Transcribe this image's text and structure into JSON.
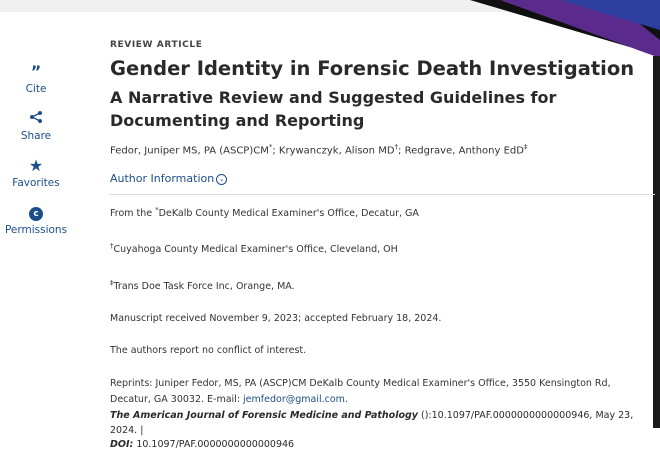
{
  "sidebar": {
    "items": [
      {
        "label": "Cite",
        "icon": "quote-icon",
        "glyph": "”"
      },
      {
        "label": "Share",
        "icon": "share-icon",
        "glyph": "<"
      },
      {
        "label": "Favorites",
        "icon": "star-icon",
        "glyph": "★"
      },
      {
        "label": "Permissions",
        "icon": "copyright-icon",
        "glyph": "c"
      }
    ]
  },
  "article": {
    "kicker": "REVIEW ARTICLE",
    "title": "Gender Identity in Forensic Death Investigation",
    "subtitle": "A Narrative Review and Suggested Guidelines for Documenting and Reporting",
    "authors": {
      "a1": "Fedor, Juniper MS, PA (ASCP)CM",
      "a1_sup": "*",
      "sep1": "; ",
      "a2": "Krywanczyk, Alison MD",
      "a2_sup": "†",
      "sep2": "; ",
      "a3": "Redgrave, Anthony EdD",
      "a3_sup": "‡"
    },
    "author_info_label": "Author Information",
    "affiliations": [
      {
        "sup": "*",
        "text": "DeKalb County Medical Examiner's Office, Decatur, GA",
        "prefix": "From the "
      },
      {
        "sup": "†",
        "text": "Cuyahoga County Medical Examiner's Office, Cleveland, OH",
        "prefix": ""
      },
      {
        "sup": "‡",
        "text": "Trans Doe Task Force Inc, Orange, MA.",
        "prefix": ""
      }
    ],
    "manuscript": "Manuscript received November 9, 2023; accepted February 18, 2024.",
    "conflict": "The authors report no conflict of interest.",
    "reprints_text": "Reprints: Juniper Fedor, MS, PA (ASCP)CM DeKalb County Medical Examiner's Office, 3550 Kensington Rd, Decatur, GA 30032. E-mail: ",
    "reprints_email": "jemfedor@gmail.com",
    "reprints_end": ".",
    "journal": "The American Journal of Forensic Medicine and Pathology",
    "citation_rest": " ():10.1097/PAF.0000000000000946, May 23, 2024. |",
    "doi_label": "DOI:",
    "doi_value": " 10.1097/PAF.0000000000000946"
  },
  "colors": {
    "accent": "#1b4f8a",
    "banner_purple": "#5a2a8c",
    "banner_blue": "#2c3f9e"
  }
}
